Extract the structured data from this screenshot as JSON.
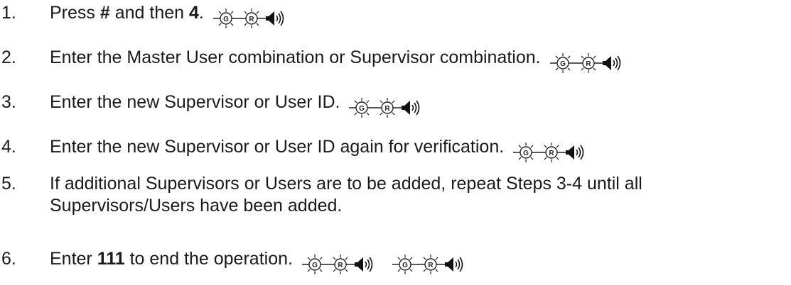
{
  "steps": [
    {
      "number": "1.",
      "parts": [
        {
          "text": "Press ",
          "bold": false
        },
        {
          "text": "#",
          "bold": true
        },
        {
          "text": " and then ",
          "bold": false
        },
        {
          "text": "4",
          "bold": true
        },
        {
          "text": ".",
          "bold": false
        }
      ],
      "indicator_groups": 1
    },
    {
      "number": "2.",
      "parts": [
        {
          "text": "Enter the Master User combination or Supervisor combination.",
          "bold": false
        }
      ],
      "indicator_groups": 1
    },
    {
      "number": "3.",
      "parts": [
        {
          "text": "Enter the new Supervisor or User ID.",
          "bold": false
        }
      ],
      "indicator_groups": 1
    },
    {
      "number": "4.",
      "parts": [
        {
          "text": "Enter the new Supervisor or User ID again for verification.",
          "bold": false
        }
      ],
      "indicator_groups": 1
    },
    {
      "number": "5.",
      "parts": [
        {
          "text": "If additional Supervisors or Users are to be added, repeat Steps 3-4 until all Supervisors/Users have been added.",
          "bold": false
        }
      ],
      "indicator_groups": 0
    },
    {
      "number": "6.",
      "parts": [
        {
          "text": "Enter ",
          "bold": false
        },
        {
          "text": "111",
          "bold": true
        },
        {
          "text": " to end the operation.",
          "bold": false
        }
      ],
      "indicator_groups": 2
    }
  ],
  "indicator": {
    "green_led_letter": "G",
    "red_led_letter": "R",
    "icons": [
      "green-led-flash-icon",
      "red-led-flash-icon",
      "beep-speaker-icon"
    ]
  }
}
